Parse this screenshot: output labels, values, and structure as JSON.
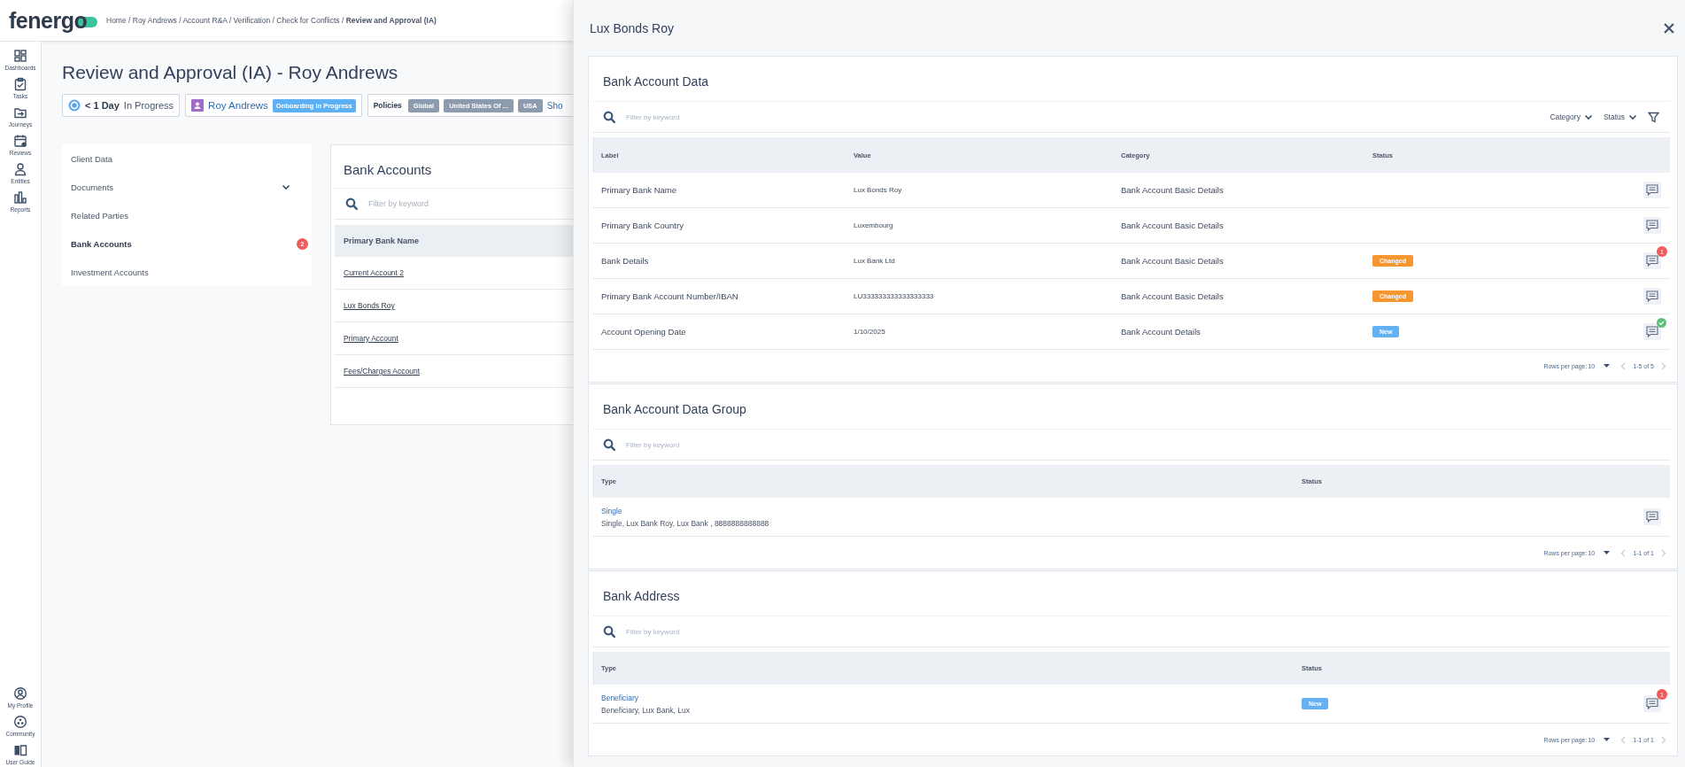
{
  "header": {
    "logo": "fenergo",
    "breadcrumb": "Home / Roy Andrews / Account R&A / Verification / Check for Conflicts / **Review and Approval (IA)**"
  },
  "nav_rail": {
    "top": [
      {
        "label": "Dashboards"
      },
      {
        "label": "Tasks"
      },
      {
        "label": "Journeys"
      },
      {
        "label": "Reviews"
      },
      {
        "label": "Entities"
      },
      {
        "label": "Reports"
      }
    ],
    "bottom": [
      {
        "label": "My Profile"
      },
      {
        "label": "Community"
      },
      {
        "label": "User Guide"
      }
    ]
  },
  "page": {
    "title": "Review and Approval (IA) - Roy Andrews",
    "timer_chip": {
      "duration": "< 1 Day",
      "status": "In Progress"
    },
    "entity_chip": {
      "name": "Roy Andrews",
      "badge": "Onboarding In Progress"
    },
    "policies_chip": {
      "label": "Policies",
      "tags": [
        "Global",
        "United States Of ...",
        "USA"
      ],
      "more": "Sho"
    }
  },
  "side_menu": [
    {
      "label": "Client Data",
      "kind": "link",
      "selected": false
    },
    {
      "label": "Documents",
      "kind": "group",
      "selected": false
    },
    {
      "label": "Related Parties",
      "kind": "link",
      "selected": false
    },
    {
      "label": "Bank Accounts",
      "kind": "link",
      "selected": true,
      "badge": "2"
    },
    {
      "label": "Investment Accounts",
      "kind": "link",
      "selected": false
    }
  ],
  "bank_accounts": {
    "title": "Bank Accounts",
    "filter_placeholder": "Filter by keyword",
    "column": "Primary Bank Name",
    "rows": [
      "Current Account 2",
      "Lux Bonds Roy",
      "Primary Account",
      "Fees/Charges Account"
    ]
  },
  "drawer": {
    "title": "Lux Bonds Roy",
    "sections": [
      {
        "kind": "fields",
        "title": "Bank Account Data",
        "filter_placeholder": "Filter by keyword",
        "filters": [
          "Category",
          "Status"
        ],
        "columns": [
          "Label",
          "Value",
          "Category",
          "Status"
        ],
        "rows": [
          {
            "label": "Primary Bank Name",
            "value": "Lux Bonds Roy",
            "category": "Bank Account Basic Details"
          },
          {
            "label": "Primary Bank Country",
            "value": "Luxembourg",
            "category": "Bank Account Basic Details"
          },
          {
            "label": "Bank Details",
            "value": "Lux Bank Ltd",
            "category": "Bank Account Basic Details",
            "status": {
              "kind": "changed",
              "text": "Changed"
            },
            "comment_badge": {
              "kind": "count",
              "text": "1"
            }
          },
          {
            "label": "Primary Bank Account Number/IBAN",
            "value": "LU333333333333333333",
            "category": "Bank Account Basic Details",
            "status": {
              "kind": "changed",
              "text": "Changed"
            }
          },
          {
            "label": "Account Opening Date",
            "value": "1/10/2025",
            "category": "Bank Account Details",
            "status": {
              "kind": "new",
              "text": "New"
            },
            "comment_badge": {
              "kind": "resolved"
            }
          }
        ],
        "pagination": {
          "label": "Rows per page:",
          "size": "10",
          "range": "1-5 of 5"
        }
      },
      {
        "kind": "groups",
        "title": "Bank Account Data Group",
        "filter_placeholder": "Filter by keyword",
        "columns": [
          "Type",
          "Status"
        ],
        "rows": [
          {
            "type": "Single",
            "summary": "Single, Lux Bank Roy, Lux Bank , 8888888888888"
          }
        ],
        "pagination": {
          "label": "Rows per page:",
          "size": "10",
          "range": "1-1 of 1"
        }
      },
      {
        "kind": "groups",
        "title": "Bank Address",
        "filter_placeholder": "Filter by keyword",
        "columns": [
          "Type",
          "Status"
        ],
        "rows": [
          {
            "type": "Beneficiary",
            "summary": "Beneficiary, Lux Bank, Lux",
            "status": {
              "kind": "new",
              "text": "New"
            },
            "comment_badge": {
              "kind": "count",
              "text": "1"
            }
          }
        ],
        "pagination": {
          "label": "Rows per page:",
          "size": "10",
          "range": "1-1 of 1"
        }
      }
    ]
  }
}
